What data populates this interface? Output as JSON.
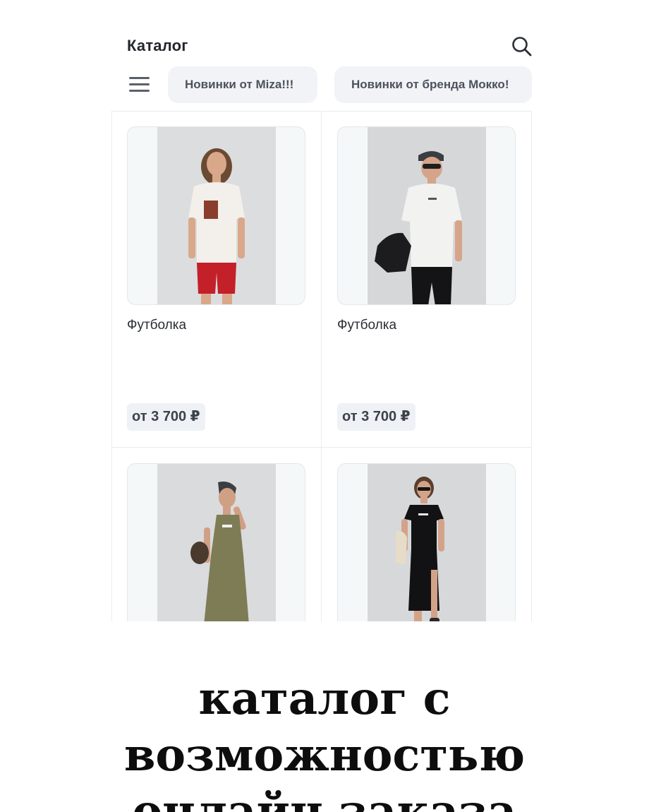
{
  "header": {
    "title": "Каталог",
    "search_icon": "search-icon"
  },
  "tabs": {
    "menu_icon": "hamburger-menu-icon",
    "items": [
      {
        "label": "Новинки от Miza!!!"
      },
      {
        "label": "Новинки от бренда Мокко!"
      }
    ]
  },
  "products": [
    {
      "name": "Футболка",
      "price": "от 3 700 ₽"
    },
    {
      "name": "Футболка",
      "price": "от 3 700 ₽"
    },
    {
      "name": "",
      "price": ""
    },
    {
      "name": "",
      "price": ""
    }
  ],
  "caption": {
    "line1": "каталог с возможностью",
    "line2": "онлайн заказа"
  },
  "colors": {
    "chip_bg": "#f1f3f7",
    "price_bg": "#eef1f5",
    "photo_bg": "#dcdddf"
  }
}
